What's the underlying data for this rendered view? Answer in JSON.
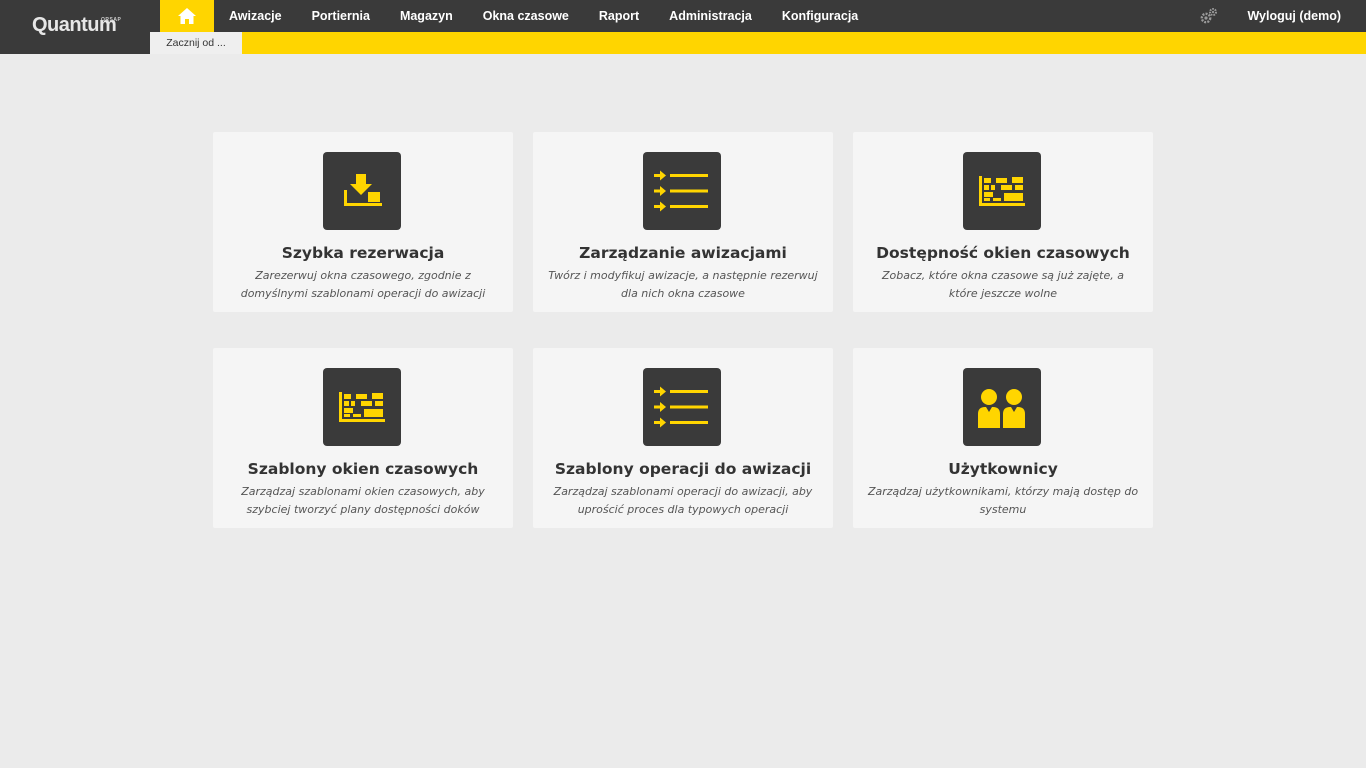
{
  "brand": {
    "name": "Quantum",
    "sup": "ORSAP"
  },
  "nav": {
    "items": [
      "Awizacje",
      "Portiernia",
      "Magazyn",
      "Okna czasowe",
      "Raport",
      "Administracja",
      "Konfiguracja"
    ],
    "logout": "Wyloguj (demo)"
  },
  "breadcrumb": {
    "tab": "Zacznij od ..."
  },
  "colors": {
    "accent": "#ffd500",
    "dark": "#3a3a3a",
    "background": "#ebebeb",
    "card": "#f5f5f5"
  },
  "cards": [
    {
      "icon": "download-tray-icon",
      "title": "Szybka rezerwacja",
      "description": "Zarezerwuj okna czasowego, zgodnie z domyślnymi szablonami operacji do awizacji"
    },
    {
      "icon": "arrow-list-icon",
      "title": "Zarządzanie awizacjami",
      "description": "Twórz i modyfikuj awizacje, a następnie rezerwuj dla nich okna czasowe"
    },
    {
      "icon": "calendar-grid-icon",
      "title": "Dostępność okien czasowych",
      "description": "Zobacz, które okna czasowe są już zajęte, a które jeszcze wolne"
    },
    {
      "icon": "calendar-grid-icon",
      "title": "Szablony okien czasowych",
      "description": "Zarządzaj szablonami okien czasowych, aby szybciej tworzyć plany dostępności doków"
    },
    {
      "icon": "arrow-list-icon",
      "title": "Szablony operacji do awizacji",
      "description": "Zarządzaj szablonami operacji do awizacji, aby uprościć proces dla typowych operacji"
    },
    {
      "icon": "users-icon",
      "title": "Użytkownicy",
      "description": "Zarządzaj użytkownikami, którzy mają dostęp do systemu"
    }
  ]
}
